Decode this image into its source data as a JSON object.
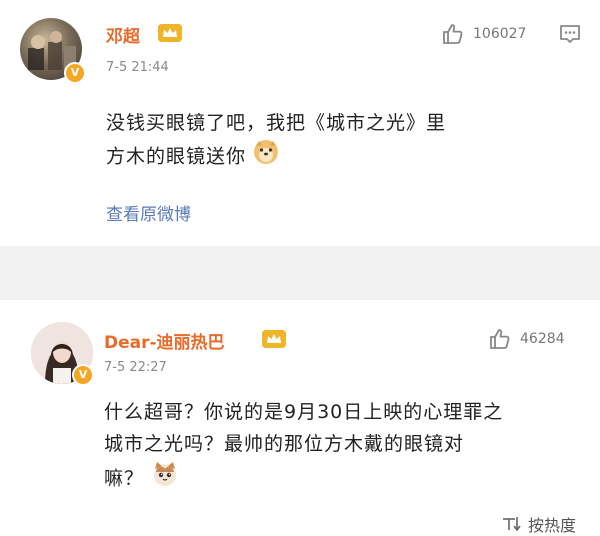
{
  "comments": [
    {
      "username": "邓超",
      "time": "7-5 21:44",
      "likes": "106027",
      "text_line1": "没钱买眼镜了吧，我把《城市之光》里",
      "text_line2": "方木的眼镜送你",
      "view_original": "查看原微博",
      "emoji": "doge-emoji"
    },
    {
      "username": "Dear-迪丽热巴",
      "time": "7-5 22:27",
      "likes": "46284",
      "text_line1": "什么超哥？你说的是9月30日上映的心理罪之",
      "text_line2": "城市之光吗？最帅的那位方木戴的眼镜对",
      "text_line3": "嘛？",
      "emoji": "cat-emoji"
    }
  ],
  "sort": {
    "label": "按热度"
  },
  "colors": {
    "name": "#e86b2a",
    "link": "#5a7ab8",
    "badge": "#f5a623"
  },
  "icons": [
    "thumbs-up-icon",
    "more-icon",
    "verified-badge-icon",
    "crown-icon",
    "sort-icon"
  ]
}
